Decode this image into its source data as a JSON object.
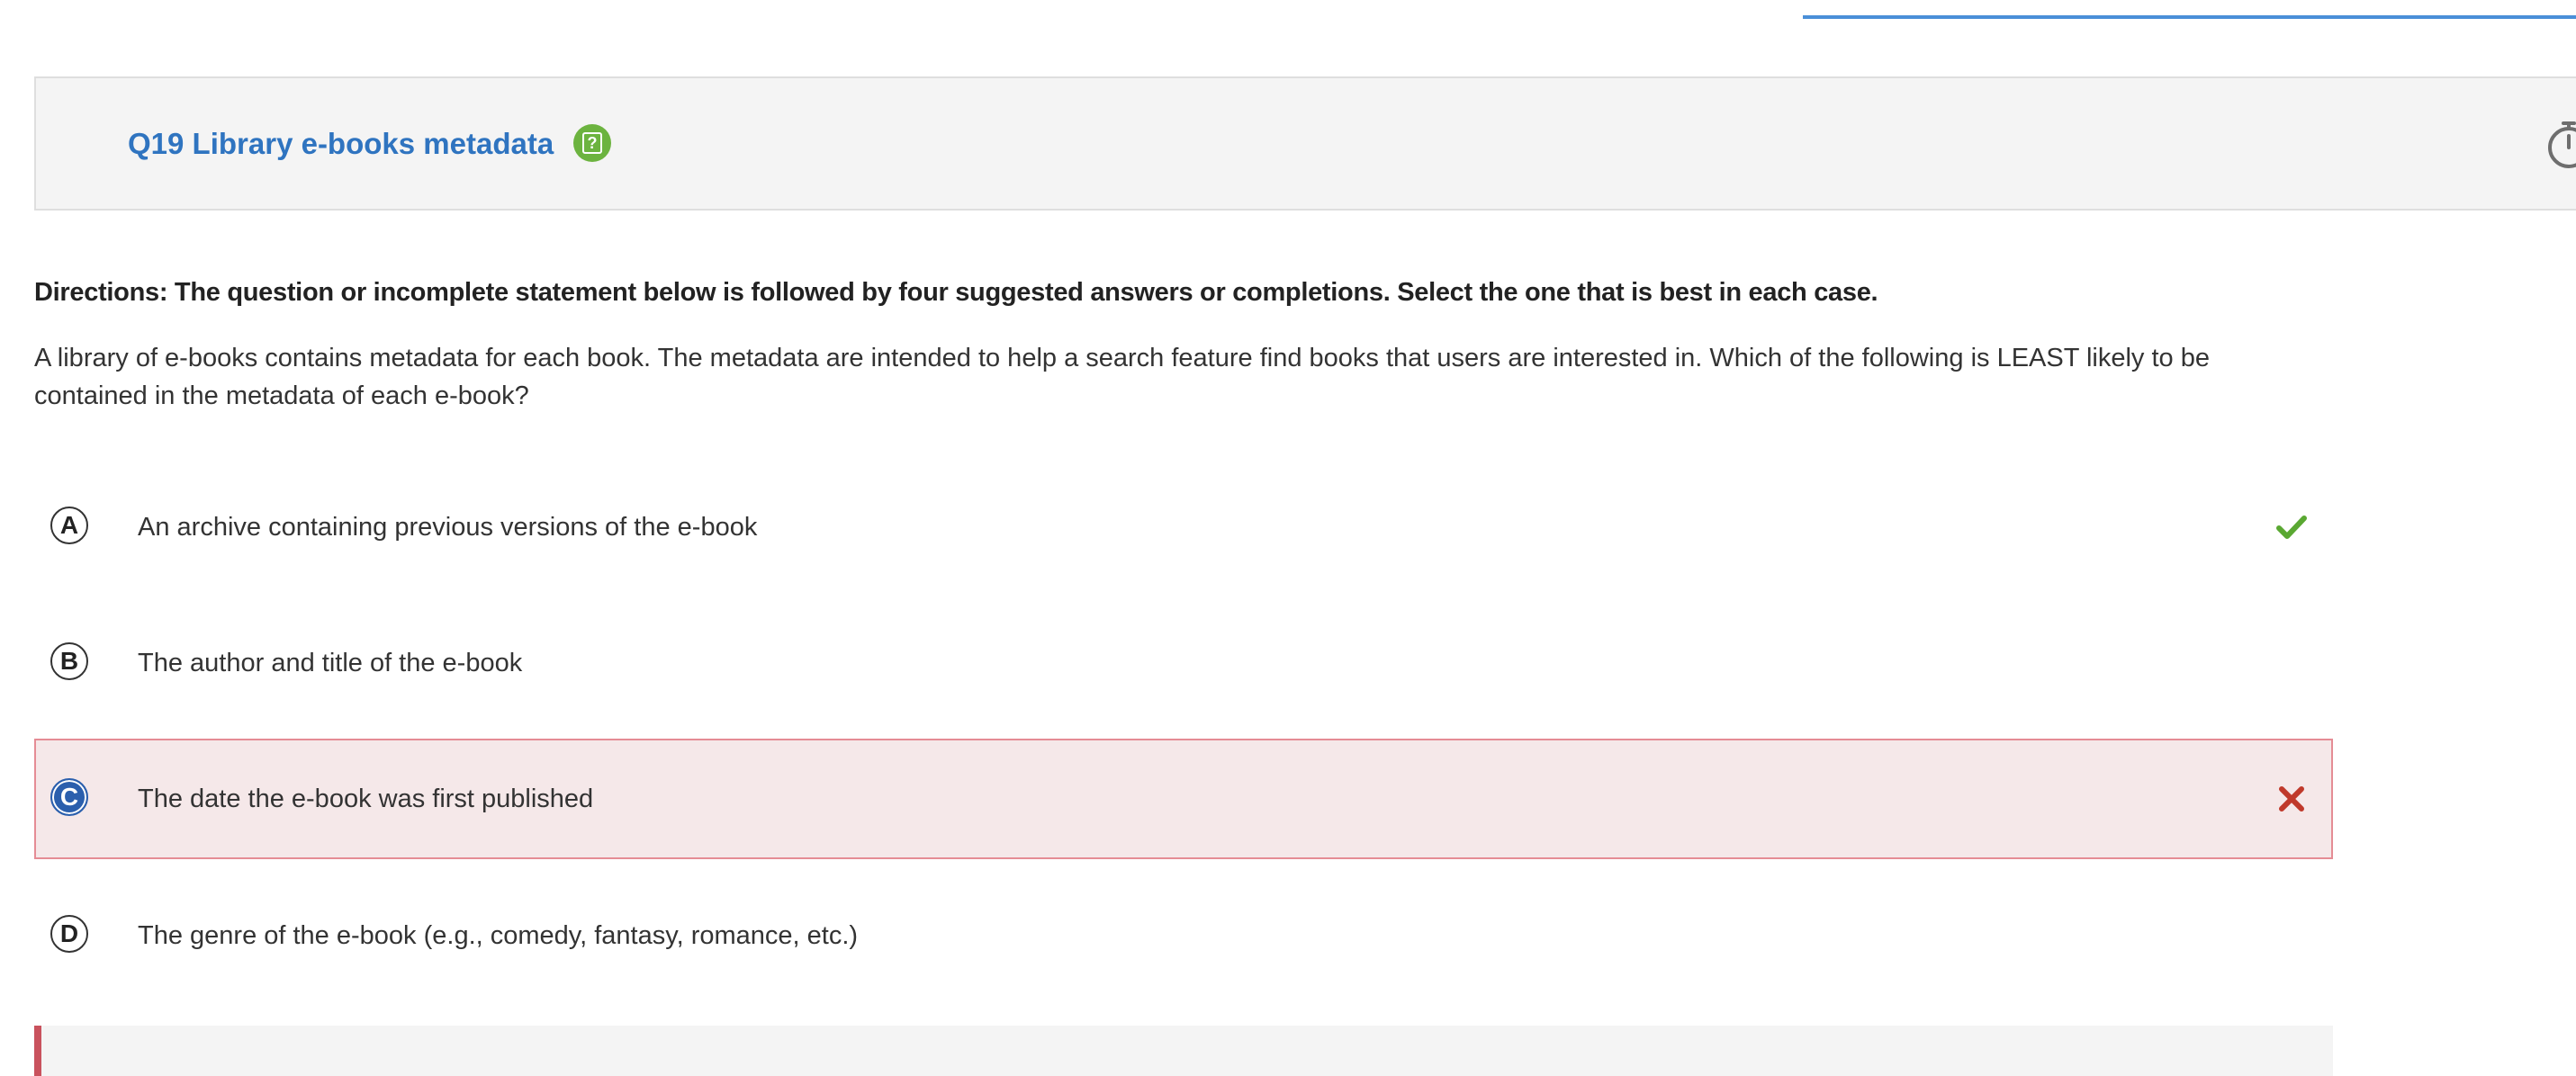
{
  "progress": {
    "color": "#4a8fd8"
  },
  "header": {
    "title": "Q19 Library e-books metadata",
    "title_color": "#2f74c0",
    "help_icon": "help-icon",
    "help_icon_glyph": "?",
    "help_icon_color": "#6cb33f",
    "timer_icon": "stopwatch-icon"
  },
  "directions": "Directions: The question or incomplete statement below is followed by four suggested answers or completions. Select the one that is best in each case.",
  "question": "A library of e-books contains metadata for each book. The metadata are intended to help a search feature find books that users are interested in. Which of the following is LEAST likely to be contained in the metadata of each e-book?",
  "options": [
    {
      "letter": "A",
      "text": "An archive containing previous versions of the e-book",
      "status": "correct",
      "status_icon": "checkmark-icon",
      "status_color": "#5aa832"
    },
    {
      "letter": "B",
      "text": "The author and title of the e-book",
      "status": "none"
    },
    {
      "letter": "C",
      "text": "The date the e-book was first published",
      "status": "selected-wrong",
      "status_icon": "x-mark-icon",
      "status_color": "#c0392b",
      "highlight_background": "#f5e8e9",
      "highlight_border": "#e58c95",
      "selected_color": "#2b5fad"
    },
    {
      "letter": "D",
      "text": "The genre of the e-book (e.g., comedy, fantasy, romance, etc.)",
      "status": "none"
    }
  ],
  "feedback": {
    "accent_color": "#c9525d"
  }
}
